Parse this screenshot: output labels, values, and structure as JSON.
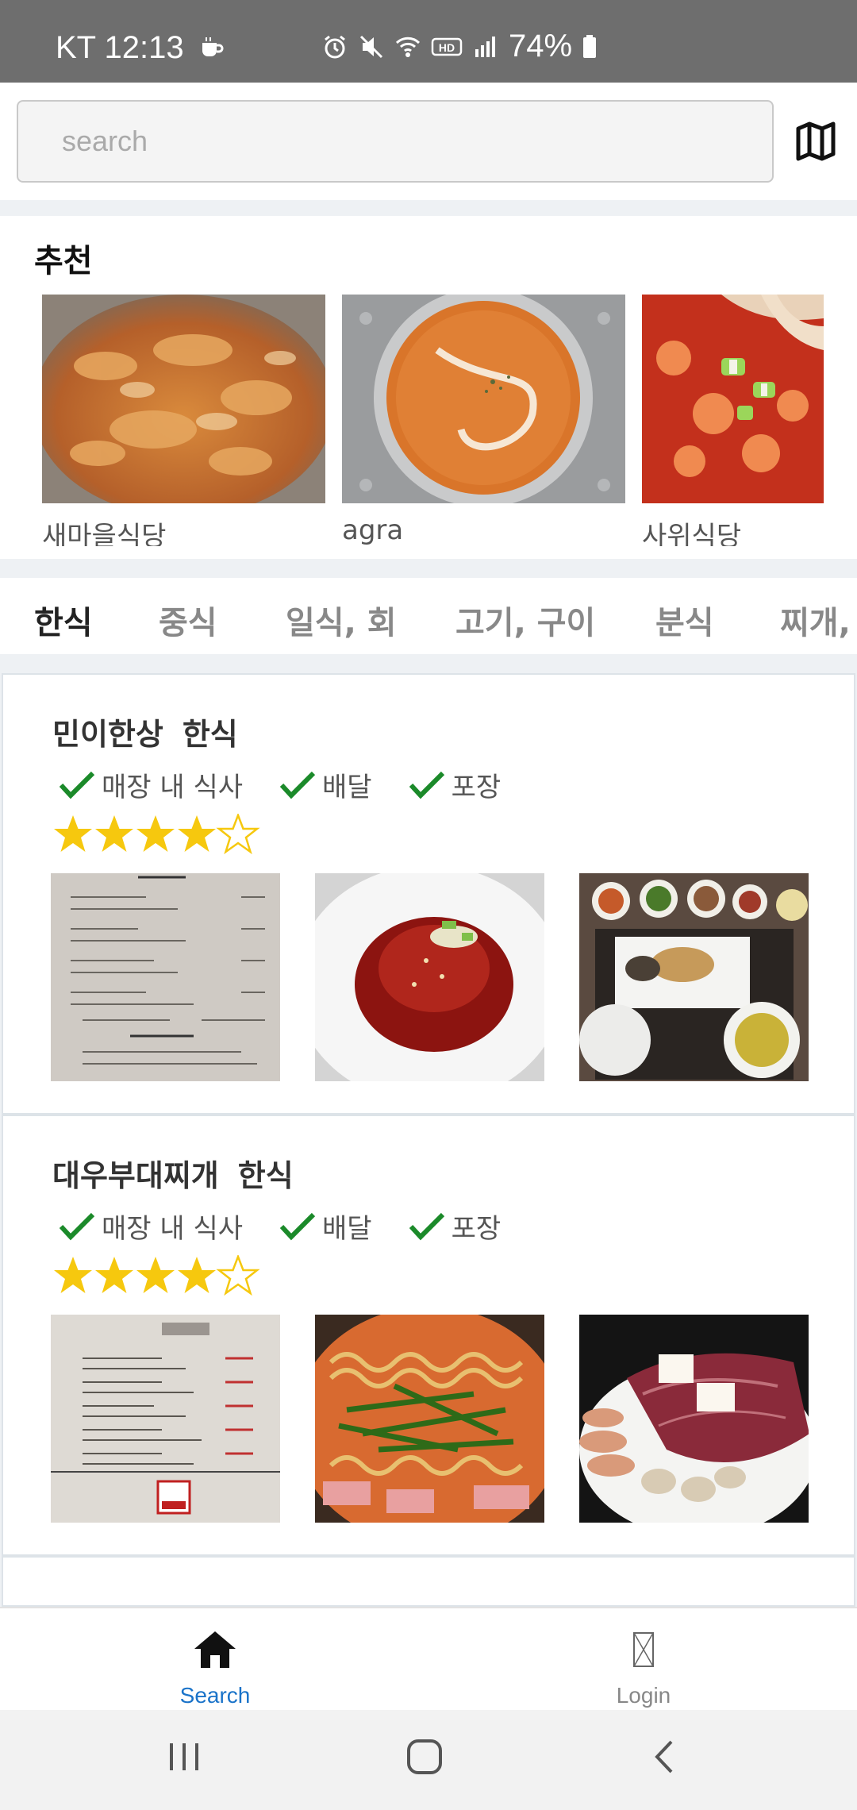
{
  "status_bar": {
    "carrier_time": "KT 12:13",
    "battery": "74%",
    "icons": [
      "coffee-icon",
      "alarm-icon",
      "mute-icon",
      "wifi-icon",
      "hd-icon",
      "signal-icon",
      "battery-icon"
    ]
  },
  "search": {
    "placeholder": "search",
    "value": ""
  },
  "reco": {
    "title": "추천",
    "items": [
      {
        "name": "새마을식당",
        "photo": "stir-fried-pork"
      },
      {
        "name": "agra",
        "photo": "curry"
      },
      {
        "name": "사위식당",
        "photo": "spicy-seafood"
      }
    ]
  },
  "categories": [
    "한식",
    "중식",
    "일식, 회",
    "고기, 구이",
    "분식",
    "찌개,"
  ],
  "active_category": "한식",
  "restaurants": [
    {
      "name": "민이한상",
      "category": "한식",
      "services": [
        "매장 내 식사",
        "배달",
        "포장"
      ],
      "rating": 4.5,
      "photos": [
        "menu-board",
        "spicy-dish",
        "set-meal"
      ]
    },
    {
      "name": "대우부대찌개",
      "category": "한식",
      "services": [
        "매장 내 식사",
        "배달",
        "포장"
      ],
      "rating": 4.5,
      "photos": [
        "menu-board",
        "budae-jjigae",
        "steak"
      ]
    }
  ],
  "bottom_nav": {
    "search": "Search",
    "login": "Login"
  },
  "colors": {
    "accent": "#1a73c9",
    "check": "#1b8a2a",
    "star": "#f6c80e"
  }
}
